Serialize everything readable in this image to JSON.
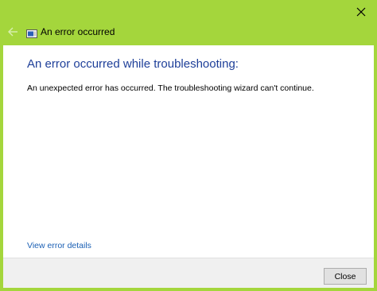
{
  "window": {
    "frame_color": "#a4d63c",
    "close_icon": "close-icon"
  },
  "header": {
    "back_icon": "back-arrow-icon",
    "app_icon": "troubleshooter-icon",
    "title": "An error occurred"
  },
  "content": {
    "heading": "An error occurred while troubleshooting:",
    "heading_color": "#1e3f99",
    "message": "An unexpected error has occurred. The troubleshooting wizard can't continue.",
    "details_link": "View error details",
    "link_color": "#1a5fb4"
  },
  "footer": {
    "close_label": "Close"
  }
}
